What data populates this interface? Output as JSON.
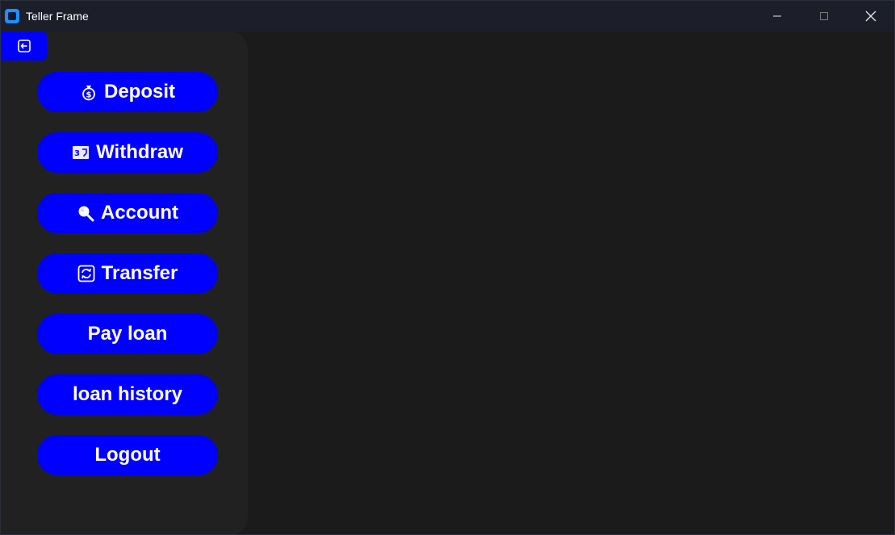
{
  "window": {
    "title": "Teller Frame",
    "controls": {
      "minimize": "minimize-icon",
      "maximize": "maximize-icon",
      "close": "close-icon"
    }
  },
  "colors": {
    "accent": "#0000ff",
    "sidebar_bg": "#212121",
    "content_bg": "#1b1b1b",
    "titlebar_bg": "#1c1f2a",
    "text": "#ffffff"
  },
  "sidebar": {
    "back_icon": "back-arrow-icon",
    "items": [
      {
        "label": "Deposit",
        "icon": "money-bag-icon"
      },
      {
        "label": "Withdraw",
        "icon": "cash-withdraw-icon"
      },
      {
        "label": "Account",
        "icon": "magnifier-icon"
      },
      {
        "label": "Transfer",
        "icon": "transfer-arrows-icon"
      },
      {
        "label": "Pay loan",
        "icon": ""
      },
      {
        "label": "loan history",
        "icon": ""
      },
      {
        "label": "Logout",
        "icon": ""
      }
    ]
  }
}
